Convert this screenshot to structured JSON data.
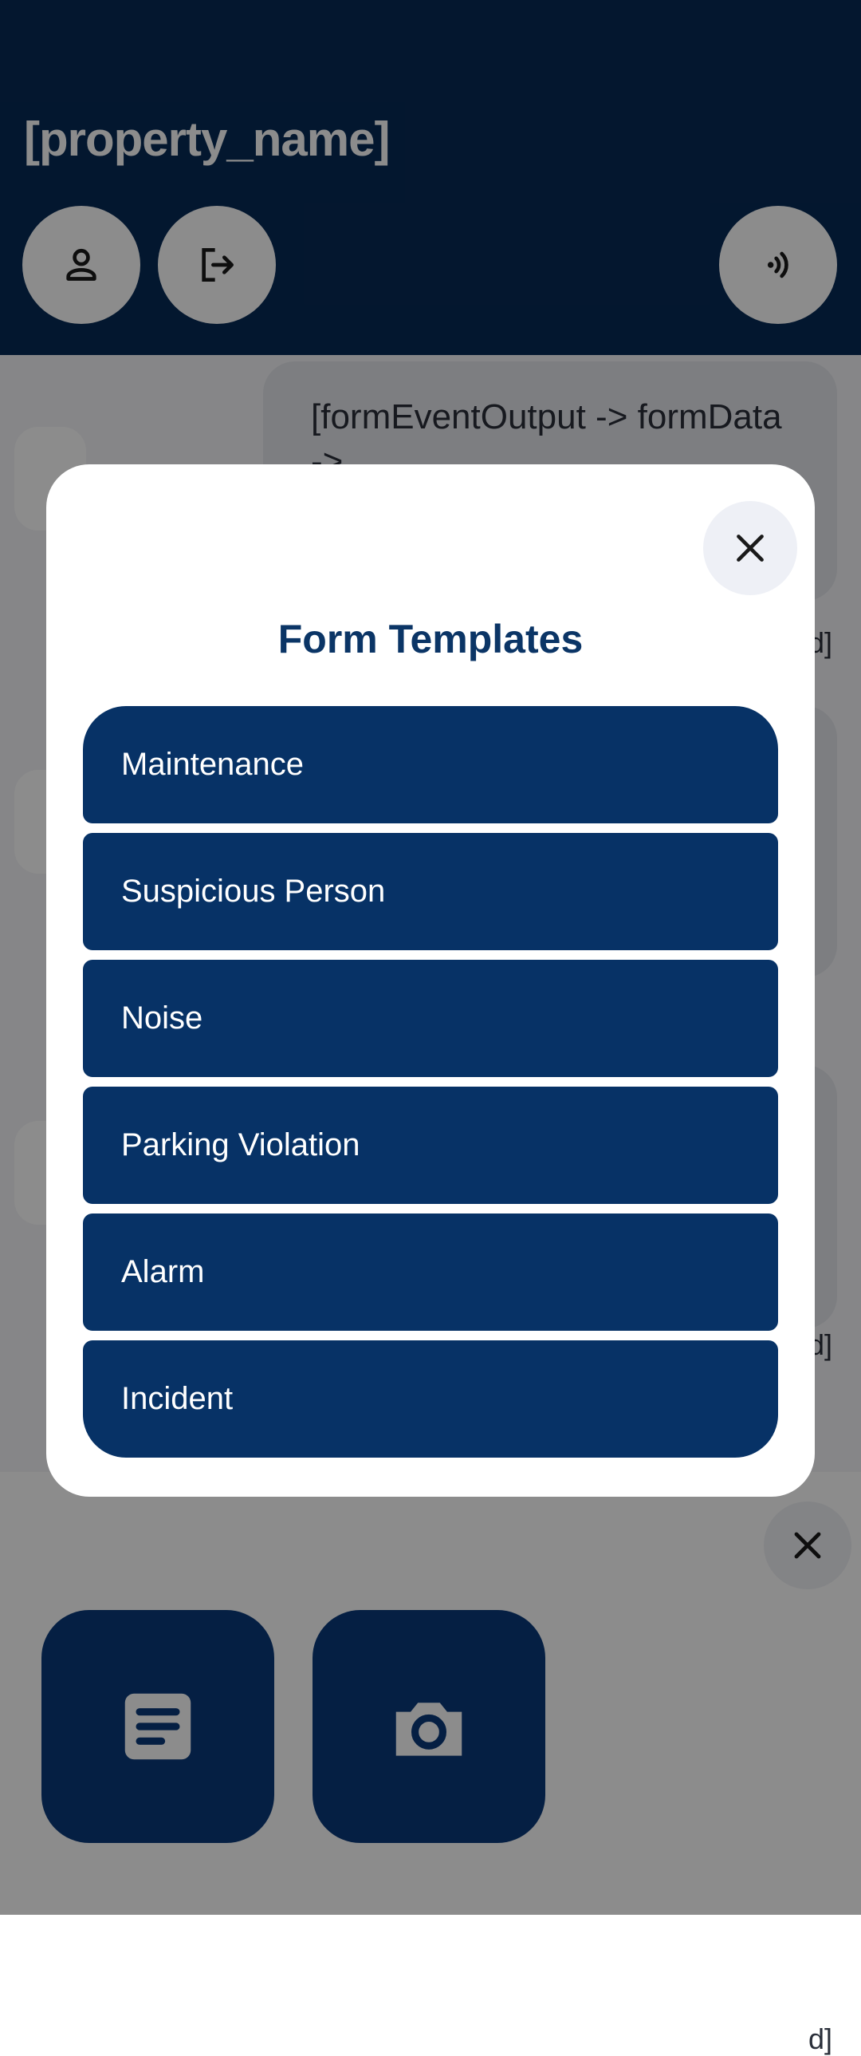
{
  "header": {
    "property_title": "[property_name]",
    "buttons": [
      {
        "icon": "person-icon"
      },
      {
        "icon": "logout-icon"
      },
      {
        "icon": "nfc-signal-icon"
      }
    ]
  },
  "background_cards": [
    {
      "text": "[formEventOutput -> formData ->",
      "suffix": "d]"
    },
    {
      "text": "",
      "suffix": "d]"
    },
    {
      "text": "",
      "suffix": "d]"
    }
  ],
  "bottom_sheet": {
    "actions": [
      {
        "icon": "document-icon"
      },
      {
        "icon": "camera-icon"
      }
    ]
  },
  "dialog": {
    "title": "Form Templates",
    "templates": [
      {
        "label": "Maintenance"
      },
      {
        "label": "Suspicious Person"
      },
      {
        "label": "Noise"
      },
      {
        "label": "Parking Violation"
      },
      {
        "label": "Alarm"
      },
      {
        "label": "Incident"
      }
    ]
  },
  "colors": {
    "brand_navy": "#072a56",
    "template_button": "#073266",
    "title_text": "#0b3566"
  }
}
